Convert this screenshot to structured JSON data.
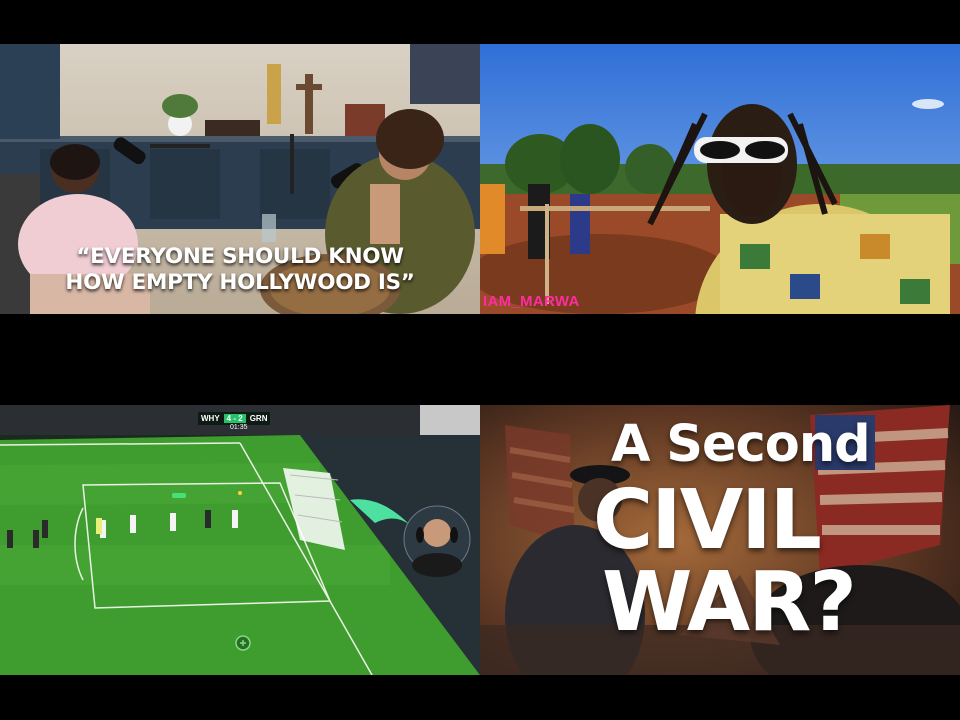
{
  "tiles": [
    {
      "id": "tile-podcast",
      "caption_line1": "“EVERYONE SHOULD KNOW",
      "caption_line2": "HOW EMPTY HOLLYWOOD IS”"
    },
    {
      "id": "tile-vlog",
      "watermark": "IAM_MARWA"
    },
    {
      "id": "tile-football",
      "score_home": "WHY",
      "score": "4 - 2",
      "score_away": "GRN",
      "clock": "01:35"
    },
    {
      "id": "tile-civil-war",
      "title_line1": "A Second",
      "title_line2": "CIVIL",
      "title_line3": "WAR?"
    }
  ],
  "colors": {
    "background": "#000000",
    "pitch": "#3f9d2f",
    "accent_pink": "#ff2ca0"
  }
}
